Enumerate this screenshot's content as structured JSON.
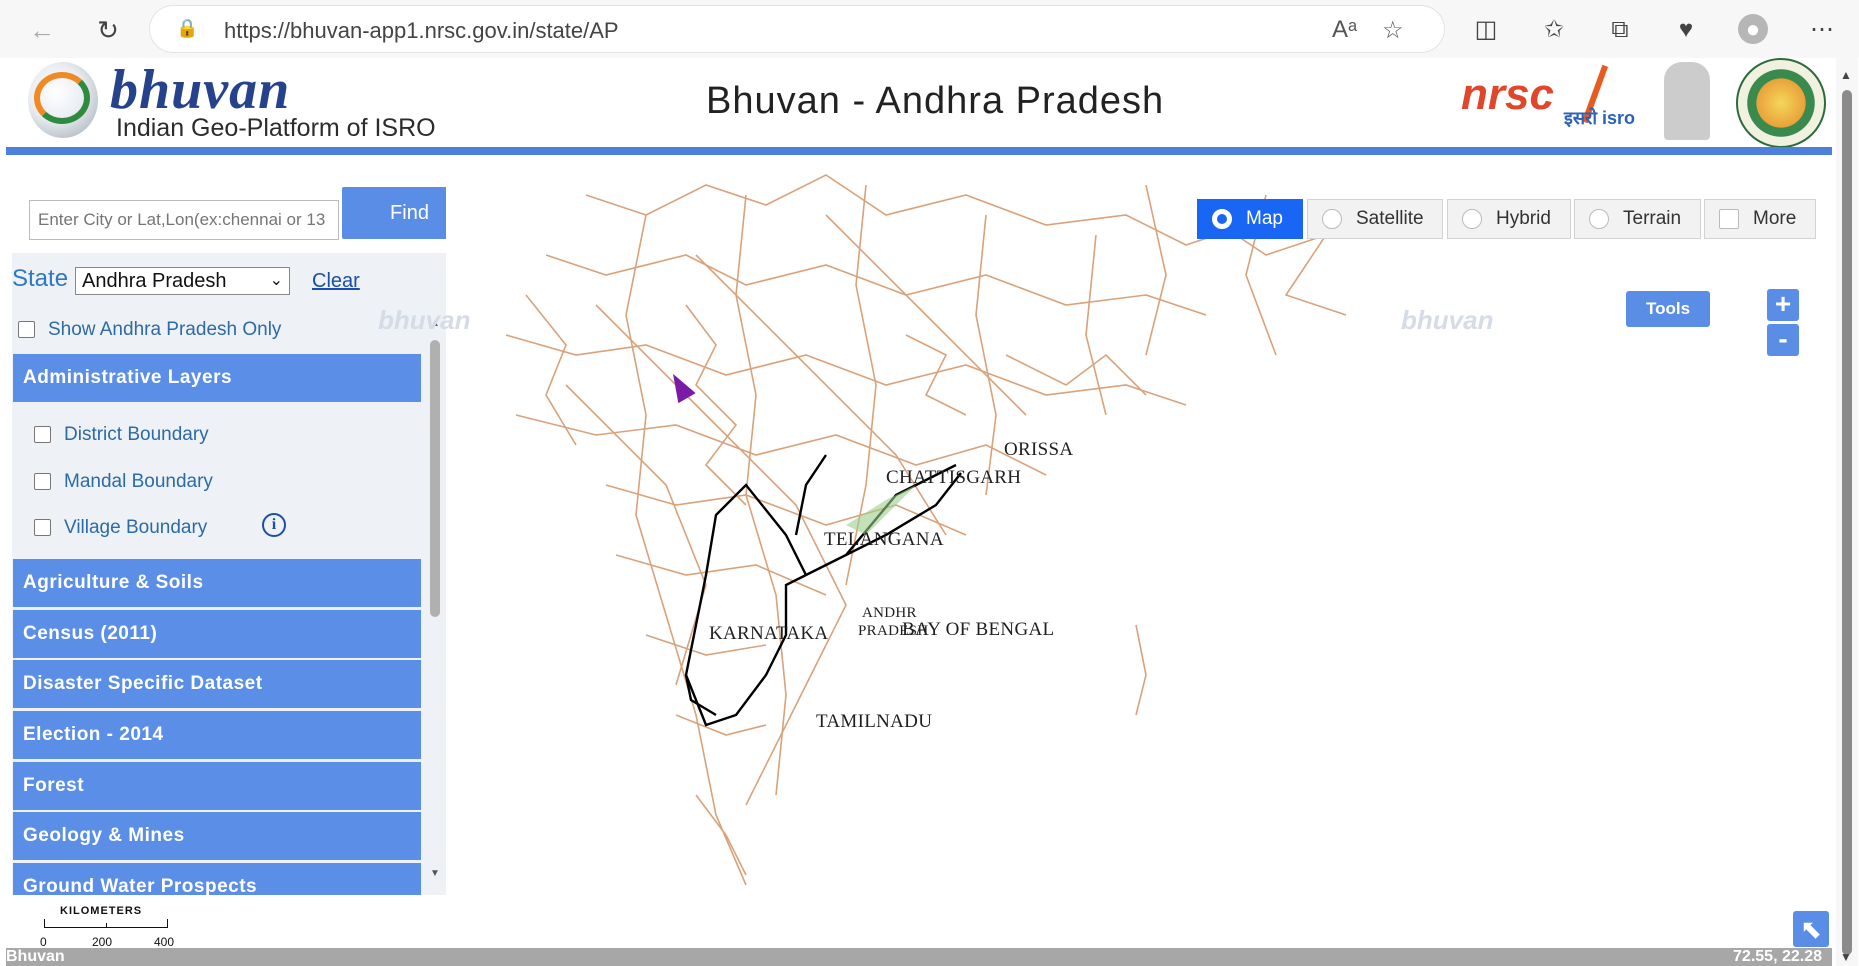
{
  "browser": {
    "url": "https://bhuvan-app1.nrsc.gov.in/state/AP",
    "icons": [
      "back-icon",
      "refresh-icon",
      "lock-icon",
      "read-aloud-icon",
      "favorite-star-icon",
      "split-screen-icon",
      "favorites-icon",
      "collections-icon",
      "performance-icon",
      "profile-icon",
      "more-icon"
    ]
  },
  "header": {
    "brand": "bhuvan",
    "brand_subtitle": "Indian Geo-Platform of ISRO",
    "title": "Bhuvan - Andhra Pradesh",
    "nrsc_logo": "nrsc",
    "isro_logo": "इसरो isro"
  },
  "search": {
    "placeholder": "Enter City or Lat,Lon(ex:chennai or 13",
    "find_label": "Find"
  },
  "state_selector": {
    "label": "State",
    "selected": "Andhra Pradesh",
    "clear_label": "Clear",
    "show_only_label": "Show Andhra Pradesh Only"
  },
  "layers": {
    "admin_title": "Administrative Layers",
    "admin_items": [
      "District Boundary",
      "Mandal Boundary",
      "Village Boundary"
    ],
    "sections": [
      "Agriculture & Soils",
      "Census (2011)",
      "Disaster Specific Dataset",
      "Election - 2014",
      "Forest",
      "Geology & Mines",
      "Ground Water Prospects"
    ]
  },
  "map": {
    "types": [
      "Map",
      "Satellite",
      "Hybrid",
      "Terrain",
      "More"
    ],
    "active_type": "Map",
    "tools_label": "Tools",
    "zoom_in": "+",
    "zoom_out": "-",
    "watermark": "bhuvan",
    "places": {
      "orissa": "ORISSA",
      "chattisgarh": "CHATTISGARH",
      "telangana": "TELANGANA",
      "andhra1": "ANDHR",
      "andhra2": "PRADESH",
      "bay": "BAY OF BENGAL",
      "karnataka": "KARNATAKA",
      "tamilnadu": "TAMILNADU"
    },
    "road_color": "#d9a27a",
    "boundary_color": "#000000"
  },
  "scale": {
    "title": "KILOMETERS",
    "labels": [
      "0",
      "200",
      "400"
    ]
  },
  "footer": {
    "left": "Bhuvan",
    "coords": "72.55, 22.28"
  }
}
